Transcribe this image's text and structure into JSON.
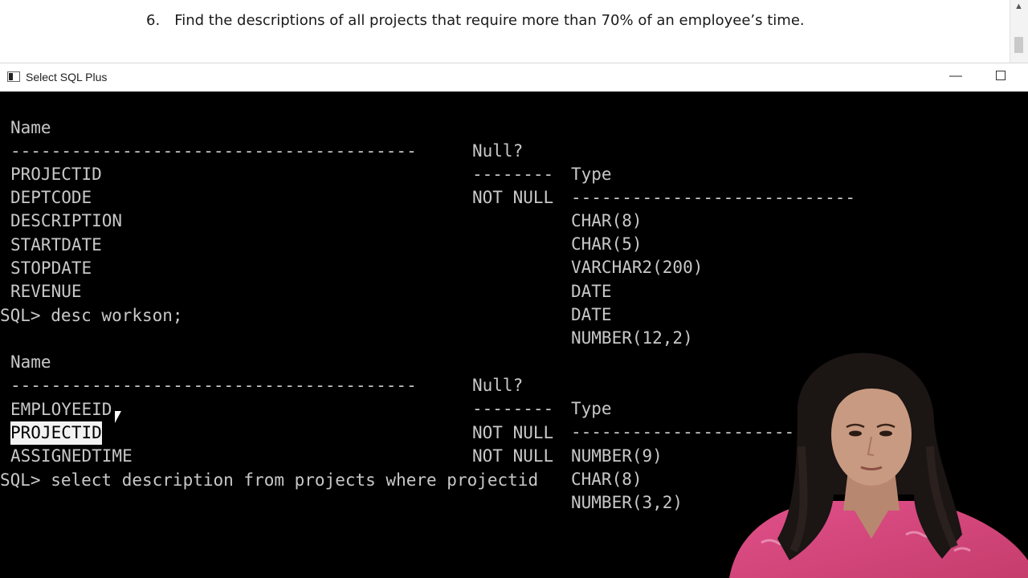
{
  "document": {
    "item_number": "6.",
    "item_text": "Find the descriptions of all projects that require more than 70% of an employee’s time."
  },
  "window": {
    "title": "Select SQL Plus",
    "minimize_icon": "minimize-icon",
    "maximize_icon": "maximize-icon"
  },
  "console": {
    "header1": {
      "name": "Name",
      "null": "Null?",
      "type": "Type"
    },
    "dash1": {
      "c1": "----------------------------------------",
      "c2": "--------",
      "c3": "----------------------------"
    },
    "projects_columns": [
      {
        "name": "PROJECTID",
        "null": "NOT NULL",
        "type": "CHAR(8)"
      },
      {
        "name": "DEPTCODE",
        "null": "",
        "type": "CHAR(5)"
      },
      {
        "name": "DESCRIPTION",
        "null": "",
        "type": "VARCHAR2(200)"
      },
      {
        "name": "STARTDATE",
        "null": "",
        "type": "DATE"
      },
      {
        "name": "STOPDATE",
        "null": "",
        "type": "DATE"
      },
      {
        "name": "REVENUE",
        "null": "",
        "type": "NUMBER(12,2)"
      }
    ],
    "prompt1": "SQL> desc workson;",
    "header2": {
      "name": "Name",
      "null": "Null?",
      "type": "Type"
    },
    "dash2": {
      "c1": "----------------------------------------",
      "c2": "--------",
      "c3": "----------------------------"
    },
    "workson_columns": [
      {
        "name": "EMPLOYEEID",
        "null": "NOT NULL",
        "type": "NUMBER(9)"
      },
      {
        "name": "PROJECTID",
        "null": "NOT NULL",
        "type": "CHAR(8)"
      },
      {
        "name": "ASSIGNEDTIME",
        "null": "",
        "type": "NUMBER(3,2)"
      }
    ],
    "prompt2": "SQL> select description from projects where projectid"
  },
  "colors": {
    "console_bg": "#000000",
    "console_text": "#c8c8c8",
    "selection_bg": "#f2f2f2",
    "shirt": "#d9477a",
    "hair": "#1b1514",
    "skin": "#c99a82"
  }
}
